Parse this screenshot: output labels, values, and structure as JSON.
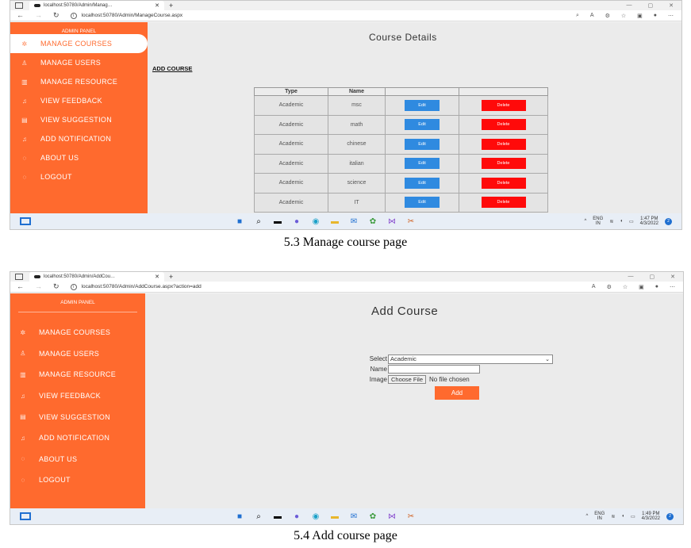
{
  "shot1": {
    "tab_title": "localhost:50780/Admin/Manag…",
    "url": "localhost:50780/Admin/ManageCourse.aspx",
    "panel_title": "ADMIN PANEL",
    "menu": [
      "MANAGE COURSES",
      "MANAGE USERS",
      "MANAGE RESOURCE",
      "VIEW FEEDBACK",
      "VIEW SUGGESTION",
      "ADD NOTIFICATION",
      "ABOUT US",
      "LOGOUT"
    ],
    "menu_icons": [
      "gear-icon",
      "user-icon",
      "book-icon",
      "bell-icon",
      "chat-icon",
      "bell-icon",
      "power-icon",
      "power-icon"
    ],
    "page_title": "Course Details",
    "add_link": "ADD COURSE",
    "table_headers": [
      "Type",
      "Name",
      "",
      ""
    ],
    "rows": [
      {
        "type": "Academic",
        "name": "msc",
        "edit": "Edit",
        "delete": "Delete"
      },
      {
        "type": "Academic",
        "name": "math",
        "edit": "Edit",
        "delete": "Delete"
      },
      {
        "type": "Academic",
        "name": "chinese",
        "edit": "Edit",
        "delete": "Delete"
      },
      {
        "type": "Academic",
        "name": "italian",
        "edit": "Edit",
        "delete": "Delete"
      },
      {
        "type": "Academic",
        "name": "science",
        "edit": "Edit",
        "delete": "Delete"
      },
      {
        "type": "Academic",
        "name": "IT",
        "edit": "Edit",
        "delete": "Delete"
      }
    ],
    "tray_lang": [
      "ENG",
      "IN"
    ],
    "tray_time": "1:47 PM",
    "tray_date": "4/3/2022",
    "tray_badge": "2"
  },
  "caption1": "5.3 Manage course page",
  "shot2": {
    "tab_title": "localhost:50780/Admin/AddCou…",
    "url": "localhost:50780/Admin/AddCourse.aspx?action=add",
    "panel_title": "ADMIN PANEL",
    "menu": [
      "MANAGE COURSES",
      "MANAGE USERS",
      "MANAGE RESOURCE",
      "VIEW FEEDBACK",
      "VIEW SUGGESTION",
      "ADD NOTIFICATION",
      "ABOUT US",
      "LOGOUT"
    ],
    "page_title": "Add Course",
    "select_label": "Select",
    "select_value": "Academic",
    "name_label": "Name",
    "name_value": "",
    "image_label": "Image",
    "choose_file": "Choose File",
    "no_file": "No file chosen",
    "add_button": "Add",
    "tray_lang": [
      "ENG",
      "IN"
    ],
    "tray_time": "1:49 PM",
    "tray_date": "4/3/2022",
    "tray_badge": "2"
  },
  "caption2": "5.4 Add course page",
  "colors": {
    "sidebar": "#ff6a2e",
    "edit_button": "#2f8ae0",
    "delete_button": "#ff0a0a",
    "page_bg": "#ebebeb"
  }
}
